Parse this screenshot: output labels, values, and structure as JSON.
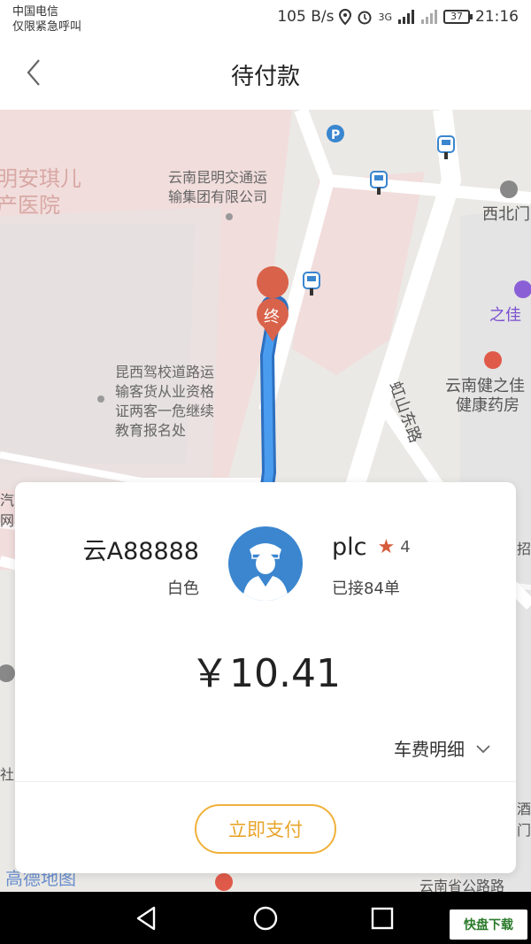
{
  "status_bar": {
    "carrier": "中国电信",
    "carrier_note": "仅限紧急呼叫",
    "net_speed": "105 B/s",
    "network": "3G",
    "battery": "37",
    "time": "21:16"
  },
  "header": {
    "title": "待付款",
    "back_icon": "chevron-left-icon"
  },
  "map": {
    "labels": {
      "hospital": "明安琪儿\n产医院",
      "transport_group": "云南昆明交通运\n输集团有限公司",
      "driving_school": "昆西驾校道路运\n输客货从业资格\n证两客一危继续\n教育报名处",
      "road": "虹山东路",
      "xibeimen": "西北门",
      "zhijia": "之佳",
      "pharmacy": "云南健之佳\n健康药房",
      "qi": "汽",
      "wang": "网",
      "zhao": "招",
      "she": "社",
      "jiu": "酒",
      "men": "门",
      "amap": "高德地图",
      "provincial_road": "云南省公路路",
      "end_marker": "终"
    },
    "colors": {
      "route": "#3a8ee6",
      "block_pink": "#f1dddc",
      "road": "#ffffff",
      "end_marker": "#d9624a",
      "bus_icon": "#3a86cf"
    }
  },
  "order_card": {
    "plate": "云A88888",
    "car_color": "白色",
    "driver_name": "plc",
    "rating": "4",
    "orders": "已接84单",
    "price": "￥10.41",
    "fee_detail": "车费明细",
    "pay_button": "立即支付",
    "colors": {
      "accent": "#f0b13a",
      "avatar_bg": "#3b86cf",
      "star": "#d75b3c"
    }
  },
  "nav_bar": {
    "icons": [
      "back-triangle-icon",
      "home-circle-icon",
      "recents-square-icon"
    ],
    "watermark": "快盘下载"
  }
}
